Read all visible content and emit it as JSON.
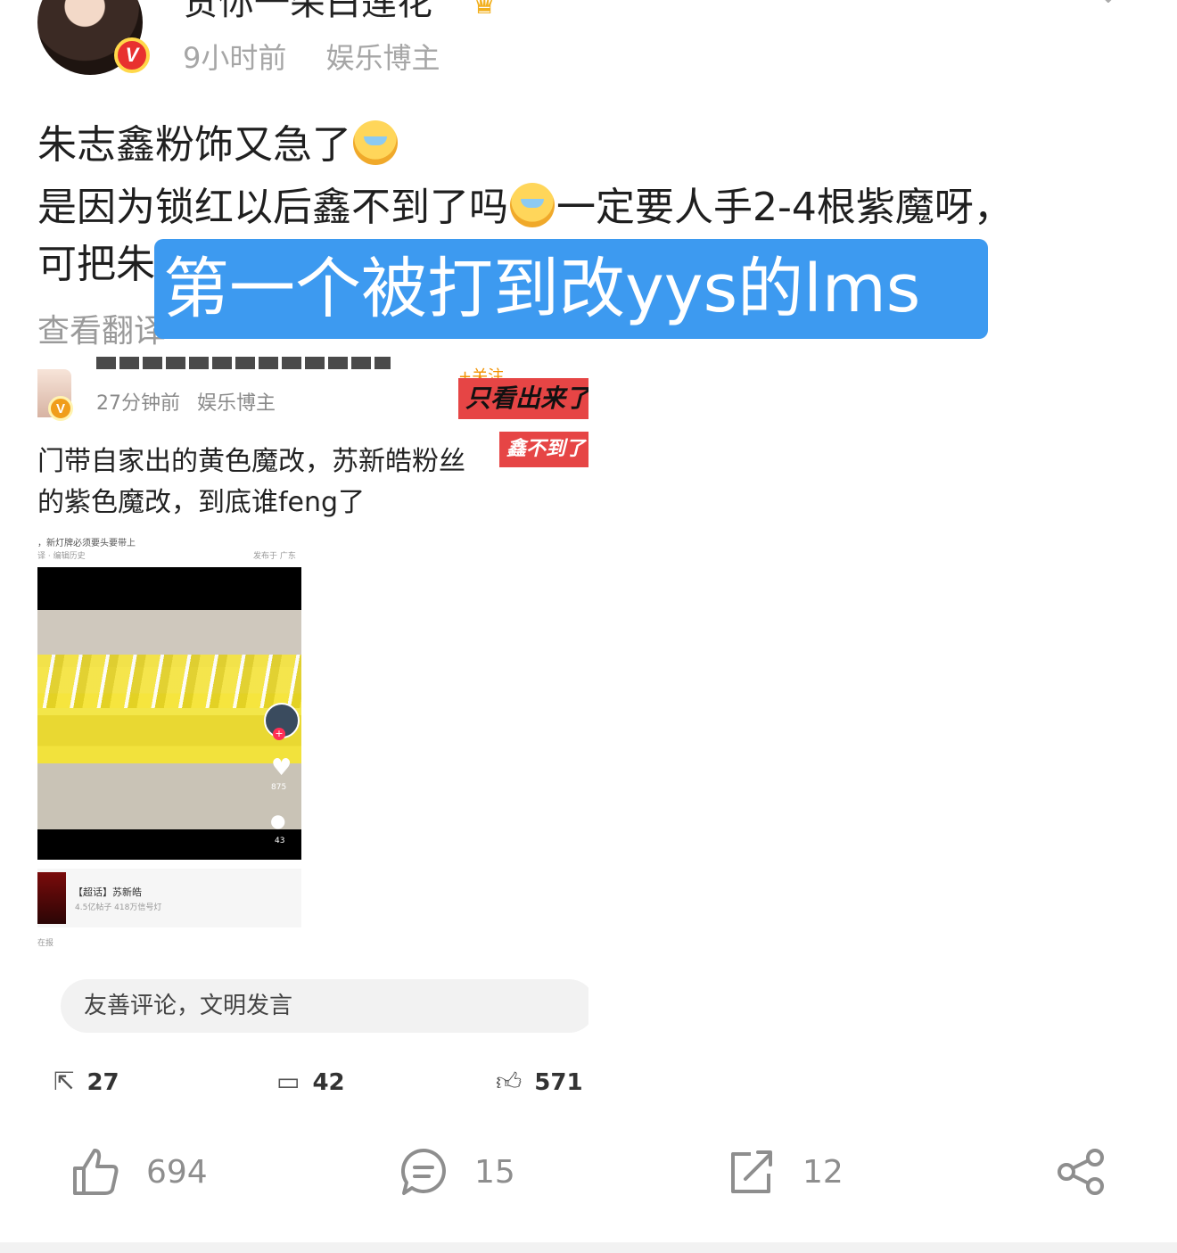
{
  "post": {
    "author": "贺你一朵白莲花",
    "time": "9小时前",
    "role": "娱乐博主",
    "avatar_badge": "V",
    "lines": [
      "朱志鑫粉饰又急了",
      "是因为锁红以后鑫不到了吗",
      "一定要人手2-4根紫魔呀，",
      "可把朱"
    ],
    "translate_partial": "查看翻译",
    "overlay_banner": "第一个被打到改yys的lms"
  },
  "embedded": {
    "meta_time": "27分钟前",
    "meta_role": "娱乐博主",
    "follow": "+关注",
    "sticker1": "只看出来了",
    "sticker2": "鑫不到了",
    "line1": "门带自家出的黄色魔改，苏新皓粉丝",
    "line2": "的紫色魔改，到底谁feng了",
    "inner": {
      "top_text": "，新灯牌必须要头要带上",
      "sub_text": "译 · 编辑历史",
      "location": "发布于 广东",
      "likes": "875",
      "comments": "43",
      "topic_title": "【超话】苏新皓",
      "topic_sub": "4.5亿帖子 418万信号灯",
      "foot": "在报"
    },
    "comment_placeholder": "友善评论，文明发言",
    "actions": {
      "repost": "27",
      "comment": "42",
      "like": "571"
    }
  },
  "actions": {
    "like": "694",
    "comment": "15",
    "repost": "12"
  },
  "colors": {
    "banner": "#3d9af0",
    "sticker": "#e64545",
    "meta_text": "#a6a6a6",
    "action_text": "#8e8e8e"
  }
}
